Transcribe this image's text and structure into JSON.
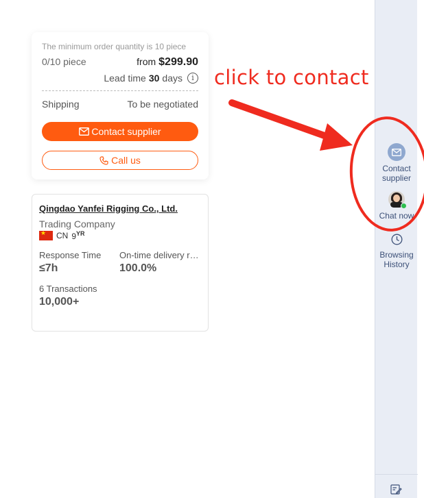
{
  "order": {
    "moq_text": "The minimum order quantity is 10 piece",
    "quantity": "0/10 piece",
    "price_prefix": "from",
    "price": "$299.90",
    "lead_prefix": "Lead time",
    "lead_days": "30",
    "lead_suffix": "days",
    "shipping_label": "Shipping",
    "shipping_value": "To be negotiated",
    "contact_button": "Contact supplier",
    "call_button": "Call us"
  },
  "supplier": {
    "name": "Qingdao Yanfei Rigging Co., Ltd.",
    "type": "Trading Company",
    "country": "CN",
    "years": "9",
    "years_unit": "YR",
    "stats": [
      {
        "label": "Response Time",
        "value": "≤7h"
      },
      {
        "label": "On-time delivery rate",
        "value": "100.0%"
      }
    ],
    "transactions_label": "6 Transactions",
    "transactions_value": "10,000+"
  },
  "annotation": {
    "text": "click to contact",
    "color": "#ef2b1f"
  },
  "sidebar": {
    "contact_line1": "Contact",
    "contact_line2": "supplier",
    "chat": "Chat now",
    "history_line1": "Browsing",
    "history_line2": "History"
  },
  "colors": {
    "accent": "#ff5b10",
    "sidebar_bg": "#e9edf5",
    "online": "#2fbf4f"
  }
}
